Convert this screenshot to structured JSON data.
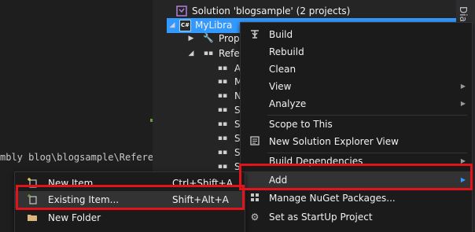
{
  "editor": {
    "path_text": "mbly blog\\blogsample\\Refere"
  },
  "solution_explorer": {
    "solution_label": "Solution 'blogsample' (2 projects)",
    "project_label": "MyLibra",
    "tree_items": [
      {
        "label": "Prop",
        "icon": "wrench-icon"
      },
      {
        "label": "Refe",
        "icon": "references-icon"
      },
      {
        "label": "A",
        "icon": "reference-icon"
      },
      {
        "label": "M",
        "icon": "reference-icon"
      },
      {
        "label": "N",
        "icon": "reference-icon"
      },
      {
        "label": "S",
        "icon": "reference-icon"
      },
      {
        "label": "S",
        "icon": "reference-icon"
      },
      {
        "label": "S",
        "icon": "reference-icon"
      },
      {
        "label": "S",
        "icon": "reference-icon"
      },
      {
        "label": "S",
        "icon": "reference-icon"
      },
      {
        "label": "S",
        "icon": "reference-icon"
      }
    ],
    "right_strip_label": "Diag"
  },
  "context_menu": {
    "items": [
      {
        "label": "Build",
        "icon": "build-icon"
      },
      {
        "label": "Rebuild",
        "icon": ""
      },
      {
        "label": "Clean",
        "icon": ""
      },
      {
        "label": "View",
        "icon": "",
        "submenu": true
      },
      {
        "label": "Analyze",
        "icon": "",
        "submenu": true
      },
      {
        "label": "Scope to This",
        "icon": ""
      },
      {
        "label": "New Solution Explorer View",
        "icon": "new-explorer-view-icon"
      },
      {
        "label": "Build Dependencies",
        "icon": "",
        "submenu": true
      },
      {
        "label": "Add",
        "icon": "",
        "submenu": true,
        "highlighted": true
      },
      {
        "label": "Manage NuGet Packages...",
        "icon": "nuget-icon"
      },
      {
        "label": "Set as StartUp Project",
        "icon": "gear-icon"
      }
    ]
  },
  "add_submenu": {
    "items": [
      {
        "label": "New Item...",
        "shortcut": "Ctrl+Shift+A",
        "icon": "new-item-icon"
      },
      {
        "label": "Existing Item...",
        "shortcut": "Shift+Alt+A",
        "icon": "existing-item-icon",
        "highlighted": true
      },
      {
        "label": "New Folder",
        "shortcut": "",
        "icon": "folder-icon"
      }
    ]
  },
  "colors": {
    "selection": "#3399ff",
    "highlight_box": "#e0141a",
    "menu_bg": "#1b1b1c"
  }
}
